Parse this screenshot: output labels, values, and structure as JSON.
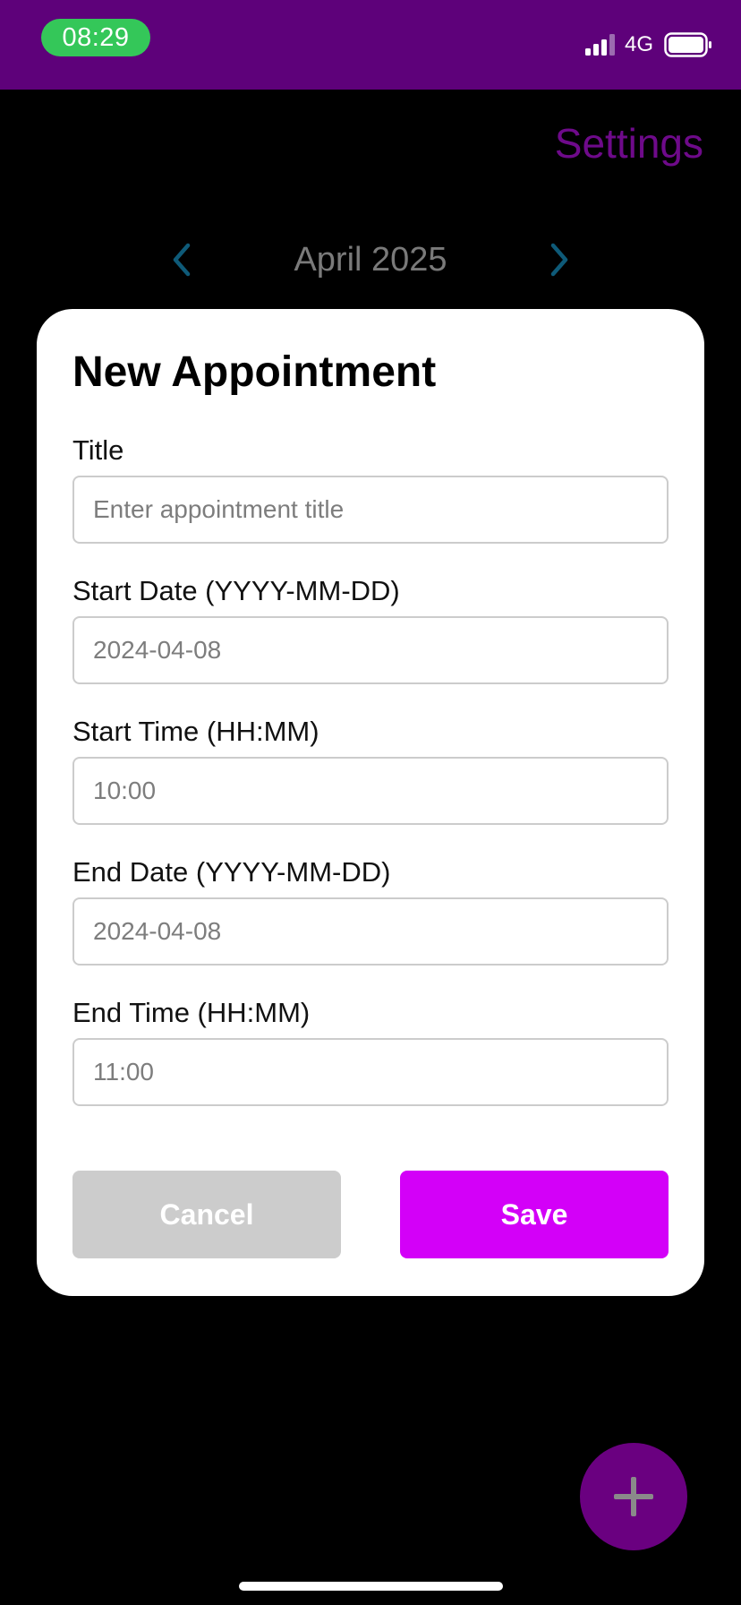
{
  "status_bar": {
    "time": "08:29",
    "network": "4G",
    "background_color": "#5e017a",
    "time_pill_color": "#34c759"
  },
  "header": {
    "settings_label": "Settings",
    "month_title": "April 2025",
    "prev_icon": "chevron-left-icon",
    "next_icon": "chevron-right-icon"
  },
  "modal": {
    "title": "New Appointment",
    "fields": [
      {
        "label": "Title",
        "value": "",
        "placeholder": "Enter appointment title"
      },
      {
        "label": "Start Date (YYYY-MM-DD)",
        "value": "",
        "placeholder": "2024-04-08"
      },
      {
        "label": "Start Time (HH:MM)",
        "value": "",
        "placeholder": "10:00"
      },
      {
        "label": "End Date (YYYY-MM-DD)",
        "value": "",
        "placeholder": "2024-04-08"
      },
      {
        "label": "End Time (HH:MM)",
        "value": "",
        "placeholder": "11:00"
      }
    ],
    "cancel_label": "Cancel",
    "save_label": "Save"
  },
  "fab": {
    "icon": "plus-icon",
    "color": "#6a0080"
  },
  "colors": {
    "accent": "#d300f8",
    "cancel": "#cccccc",
    "chevron": "#0e5a78"
  }
}
